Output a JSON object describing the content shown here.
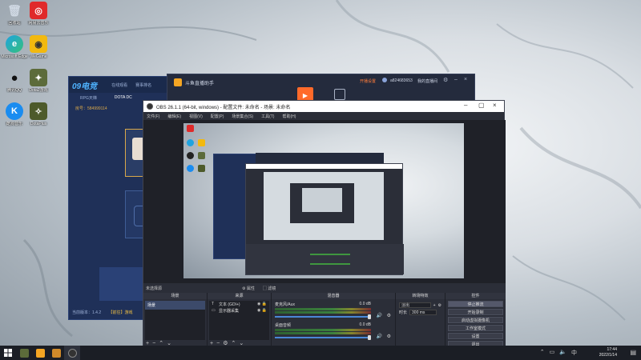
{
  "desktop": {
    "icons": [
      {
        "label": "回收站",
        "name": "recycle-bin-icon"
      },
      {
        "label": "网易云音乐",
        "name": "netease-music-icon"
      },
      {
        "label": "Microsoft Edge",
        "name": "edge-icon"
      },
      {
        "label": "WeGame",
        "name": "wegame-icon"
      },
      {
        "label": "腾讯QQ",
        "name": "qq-icon"
      },
      {
        "label": "Dota2游戏",
        "name": "dota2-icon"
      },
      {
        "label": "酷狗音乐",
        "name": "kugou-icon"
      },
      {
        "label": "DotaPlus",
        "name": "dotaplus-icon"
      }
    ]
  },
  "launcher": {
    "logo": "09电竞",
    "nav": [
      "在线观看",
      "赛事排名"
    ],
    "subtabs": [
      "RPG天梯",
      "DOTA DC"
    ],
    "room": "房号：584999114",
    "footer": "当前版本：1.4.2",
    "footer_btn": "【前往】游戏"
  },
  "douyu": {
    "title": "斗鱼直播助手",
    "vip": "开播设置",
    "user": "a824683653",
    "user_tag": "我的直播间"
  },
  "obs": {
    "title": "OBS 26.1.1 (64-bit, windows) - 配置文件: 未命名 - 场景: 未命名",
    "menu": [
      "文件(F)",
      "编辑(E)",
      "视图(V)",
      "配置(P)",
      "场景集合(S)",
      "工具(T)",
      "帮助(H)"
    ],
    "selected_source": "未选择源",
    "scene_btns": [
      "⚙ 属性",
      "▢ 滤镜"
    ],
    "docks": {
      "scenes": {
        "title": "场景",
        "items": [
          "场景"
        ]
      },
      "sources": {
        "title": "来源",
        "items": [
          {
            "icon": "T",
            "label": "文本 (GDI+)"
          },
          {
            "icon": "▭",
            "label": "显示器采集"
          }
        ]
      },
      "mixer": {
        "title": "混音器",
        "channels": [
          {
            "name": "麦克风/Aux",
            "db": "0.0 dB"
          },
          {
            "name": "桌面音频",
            "db": "0.0 dB"
          }
        ]
      },
      "transitions": {
        "title": "转场特效",
        "type": "淡出",
        "duration_label": "时长",
        "duration": "300 ms"
      },
      "controls": {
        "title": "控件",
        "buttons": [
          "停止推流",
          "开始录制",
          "启动虚拟摄像机",
          "工作室模式",
          "设置",
          "退出"
        ]
      }
    }
  },
  "taskbar": {
    "time": "17:44",
    "date": "2022/1/14"
  }
}
